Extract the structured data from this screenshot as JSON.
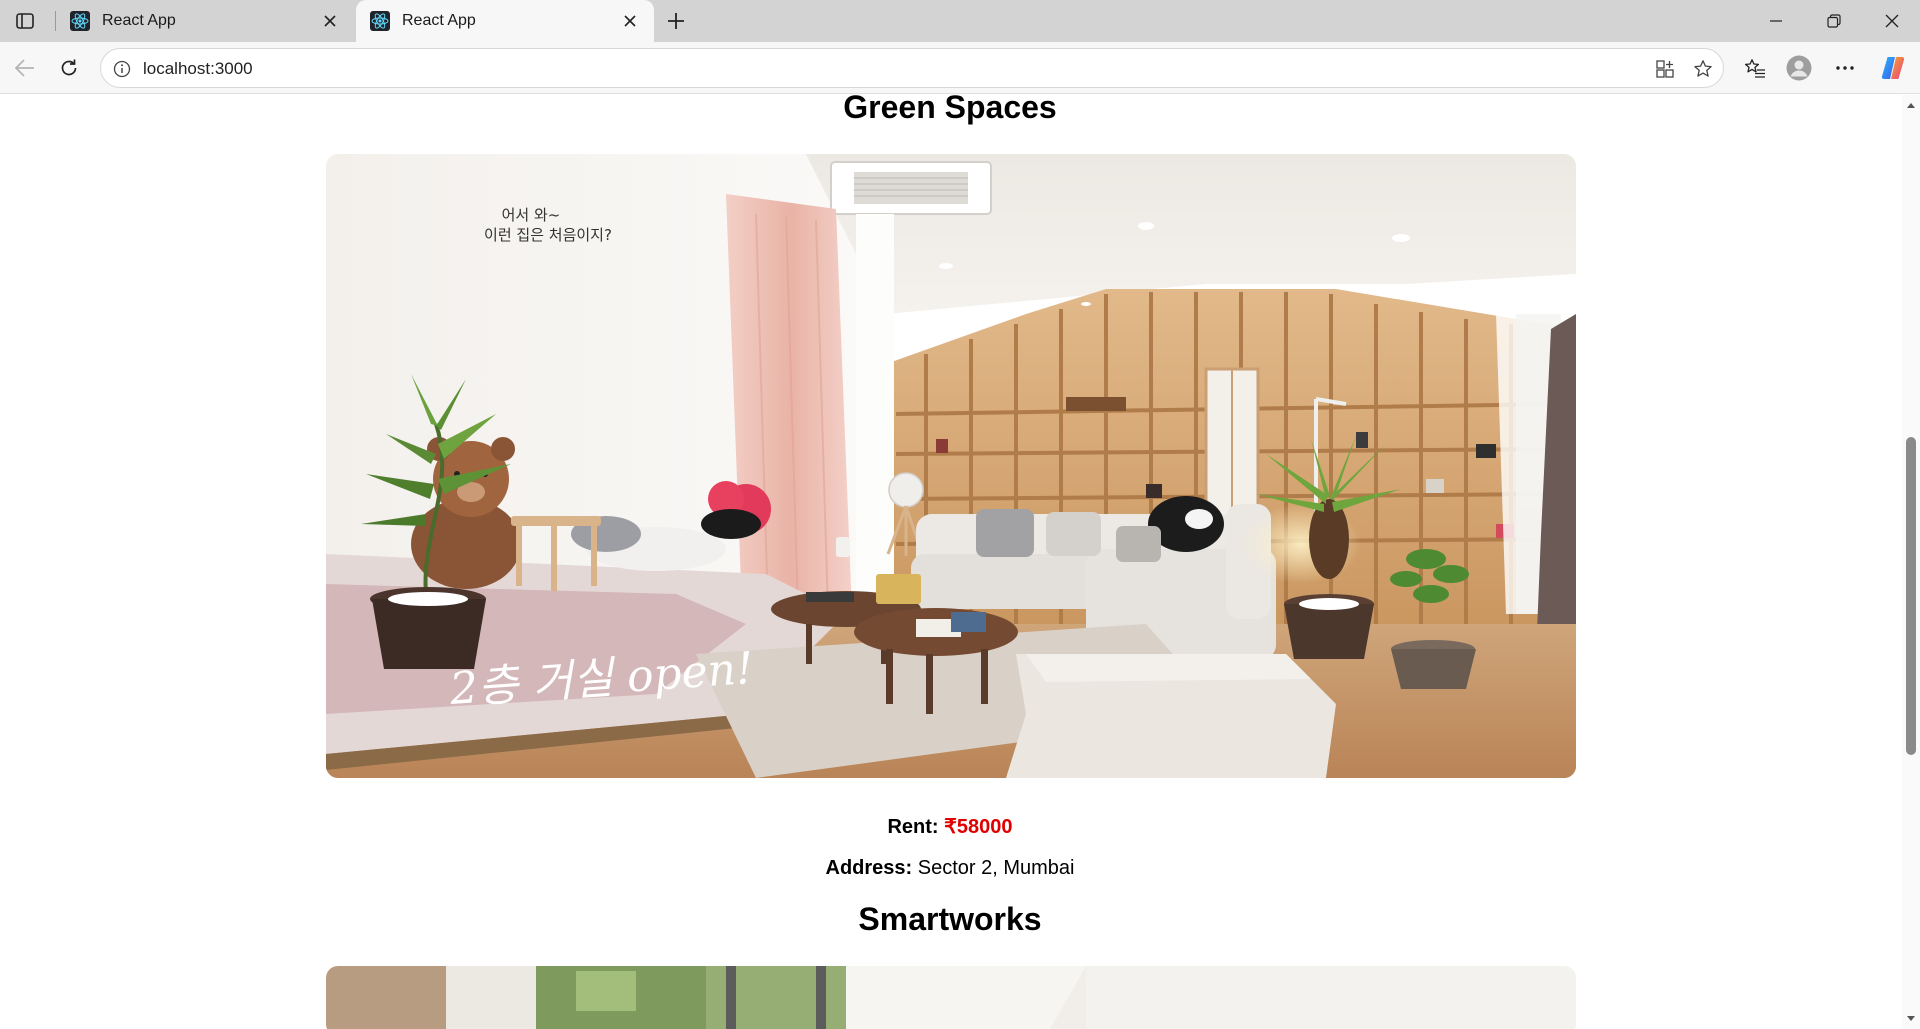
{
  "browser": {
    "tabs": [
      {
        "title": "React App",
        "active": false
      },
      {
        "title": "React App",
        "active": true
      }
    ],
    "url": "localhost:3000"
  },
  "listings": [
    {
      "name": "Green Spaces",
      "photo": {
        "overlay_caption_line1": "어서 와~",
        "overlay_caption_line2": "이런 집은 처음이지?",
        "overlay_handwriting": "2층 거실 open!"
      },
      "rent_label": "Rent:",
      "rent_value": "₹58000",
      "address_label": "Address:",
      "address_value": "Sector 2, Mumbai"
    },
    {
      "name": "Smartworks"
    }
  ],
  "colors": {
    "price": "#e00000",
    "tabbar": "#d3d3d3",
    "toolbar": "#f7f7f7"
  }
}
